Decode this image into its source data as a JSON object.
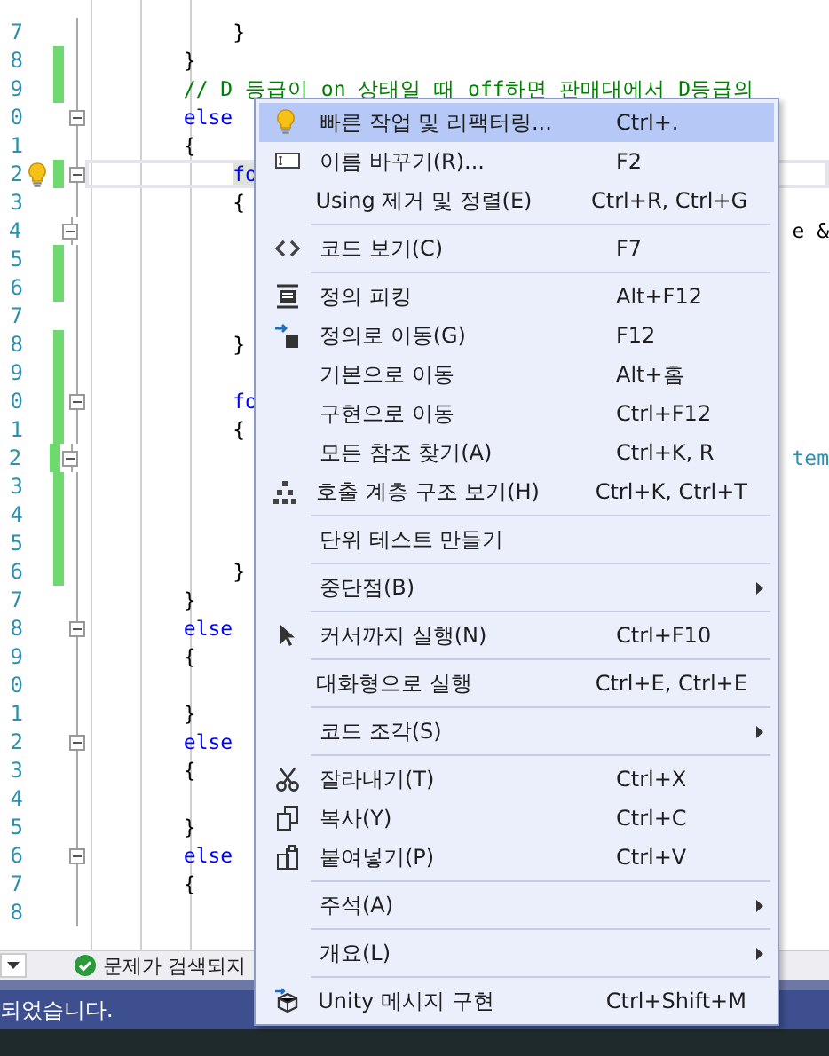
{
  "editor": {
    "lines": [
      {
        "number": "7",
        "text": "            }",
        "kind": "plain",
        "changed": false,
        "collapsible": false
      },
      {
        "number": "8",
        "text": "        }",
        "kind": "plain",
        "changed": true,
        "collapsible": false
      },
      {
        "number": "9",
        "text": "        // D 등급이 on 상태일 때 off하면 판매대에서 D등급의",
        "kind": "comment",
        "changed": true,
        "collapsible": false
      },
      {
        "number": "0",
        "text": "        else",
        "kind": "keyword",
        "changed": false,
        "collapsible": true
      },
      {
        "number": "1",
        "text": "        {",
        "kind": "plain",
        "changed": false,
        "collapsible": false
      },
      {
        "number": "2",
        "text": "            fo",
        "kind": "keyword",
        "changed": true,
        "collapsible": true,
        "current": true,
        "lightbulb": true
      },
      {
        "number": "3",
        "text": "            {",
        "kind": "plain",
        "changed": false,
        "collapsible": false
      },
      {
        "number": "4",
        "text": "                                                          e &",
        "kind": "plain",
        "changed": false,
        "collapsible": true
      },
      {
        "number": "5",
        "changed": true,
        "collapsible": false
      },
      {
        "number": "6",
        "changed": true,
        "collapsible": false
      },
      {
        "number": "7",
        "changed": false,
        "collapsible": false
      },
      {
        "number": "8",
        "text": "            }",
        "kind": "plain",
        "changed": true,
        "collapsible": false
      },
      {
        "number": "9",
        "changed": true,
        "collapsible": false
      },
      {
        "number": "0",
        "text": "            fo",
        "kind": "keyword",
        "changed": true,
        "collapsible": true
      },
      {
        "number": "1",
        "text": "            {",
        "kind": "plain",
        "changed": true,
        "collapsible": false
      },
      {
        "number": "2",
        "text": "                                                          tem",
        "kind": "identifier",
        "changed": true,
        "collapsible": true
      },
      {
        "number": "3",
        "changed": true,
        "collapsible": false
      },
      {
        "number": "4",
        "changed": true,
        "collapsible": false
      },
      {
        "number": "5",
        "changed": true,
        "collapsible": false
      },
      {
        "number": "6",
        "text": "            }",
        "kind": "plain",
        "changed": true,
        "collapsible": false
      },
      {
        "number": "7",
        "text": "        }",
        "kind": "plain",
        "changed": false,
        "collapsible": false
      },
      {
        "number": "8",
        "text": "        else",
        "kind": "keyword",
        "changed": false,
        "collapsible": true
      },
      {
        "number": "9",
        "text": "        {",
        "kind": "plain",
        "changed": false,
        "collapsible": false
      },
      {
        "number": "0",
        "changed": false,
        "collapsible": false
      },
      {
        "number": "1",
        "text": "        }",
        "kind": "plain",
        "changed": false,
        "collapsible": false
      },
      {
        "number": "2",
        "text": "        else",
        "kind": "keyword",
        "changed": false,
        "collapsible": true
      },
      {
        "number": "3",
        "text": "        {",
        "kind": "plain",
        "changed": false,
        "collapsible": false
      },
      {
        "number": "4",
        "changed": false,
        "collapsible": false
      },
      {
        "number": "5",
        "text": "        }",
        "kind": "plain",
        "changed": false,
        "collapsible": false
      },
      {
        "number": "6",
        "text": "        else",
        "kind": "keyword",
        "changed": false,
        "collapsible": true
      },
      {
        "number": "7",
        "text": "        {",
        "kind": "plain",
        "changed": false,
        "collapsible": false
      },
      {
        "number": "8",
        "changed": false,
        "collapsible": false
      }
    ]
  },
  "problems_strip": {
    "status": "문제가 검색되지"
  },
  "status_bar": {
    "text": "되었습니다."
  },
  "context_menu": {
    "items": [
      {
        "kind": "command",
        "label": "빠른 작업 및 리팩터링...",
        "shortcut": "Ctrl+.",
        "submenu": false,
        "selected": true
      },
      {
        "kind": "command",
        "label": "이름 바꾸기(R)...",
        "shortcut": "F2",
        "submenu": false,
        "selected": false
      },
      {
        "kind": "command",
        "label": "Using 제거 및 정렬(E)",
        "shortcut": "Ctrl+R, Ctrl+G",
        "submenu": false,
        "selected": false
      },
      {
        "kind": "separator"
      },
      {
        "kind": "command",
        "label": "코드 보기(C)",
        "shortcut": "F7",
        "submenu": false,
        "selected": false
      },
      {
        "kind": "separator"
      },
      {
        "kind": "command",
        "label": "정의 피킹",
        "shortcut": "Alt+F12",
        "submenu": false,
        "selected": false
      },
      {
        "kind": "command",
        "label": "정의로 이동(G)",
        "shortcut": "F12",
        "submenu": false,
        "selected": false
      },
      {
        "kind": "command",
        "label": "기본으로 이동",
        "shortcut": "Alt+홈",
        "submenu": false,
        "selected": false
      },
      {
        "kind": "command",
        "label": "구현으로 이동",
        "shortcut": "Ctrl+F12",
        "submenu": false,
        "selected": false
      },
      {
        "kind": "command",
        "label": "모든 참조 찾기(A)",
        "shortcut": "Ctrl+K, R",
        "submenu": false,
        "selected": false
      },
      {
        "kind": "command",
        "label": "호출 계층 구조 보기(H)",
        "shortcut": "Ctrl+K, Ctrl+T",
        "submenu": false,
        "selected": false
      },
      {
        "kind": "separator"
      },
      {
        "kind": "command",
        "label": "단위 테스트 만들기",
        "submenu": false,
        "selected": false
      },
      {
        "kind": "separator"
      },
      {
        "kind": "command",
        "label": "중단점(B)",
        "submenu": true,
        "selected": false
      },
      {
        "kind": "separator"
      },
      {
        "kind": "command",
        "label": "커서까지 실행(N)",
        "shortcut": "Ctrl+F10",
        "submenu": false,
        "selected": false
      },
      {
        "kind": "separator"
      },
      {
        "kind": "command",
        "label": "대화형으로 실행",
        "shortcut": "Ctrl+E, Ctrl+E",
        "submenu": false,
        "selected": false
      },
      {
        "kind": "separator"
      },
      {
        "kind": "command",
        "label": "코드 조각(S)",
        "submenu": true,
        "selected": false
      },
      {
        "kind": "separator"
      },
      {
        "kind": "command",
        "label": "잘라내기(T)",
        "shortcut": "Ctrl+X",
        "submenu": false,
        "selected": false
      },
      {
        "kind": "command",
        "label": "복사(Y)",
        "shortcut": "Ctrl+C",
        "submenu": false,
        "selected": false
      },
      {
        "kind": "command",
        "label": "붙여넣기(P)",
        "shortcut": "Ctrl+V",
        "submenu": false,
        "selected": false
      },
      {
        "kind": "separator"
      },
      {
        "kind": "command",
        "label": "주석(A)",
        "submenu": true,
        "selected": false
      },
      {
        "kind": "separator"
      },
      {
        "kind": "command",
        "label": "개요(L)",
        "submenu": true,
        "selected": false
      },
      {
        "kind": "separator"
      },
      {
        "kind": "command",
        "label": "Unity 메시지 구현",
        "shortcut": "Ctrl+Shift+M",
        "submenu": false,
        "selected": false
      }
    ]
  }
}
